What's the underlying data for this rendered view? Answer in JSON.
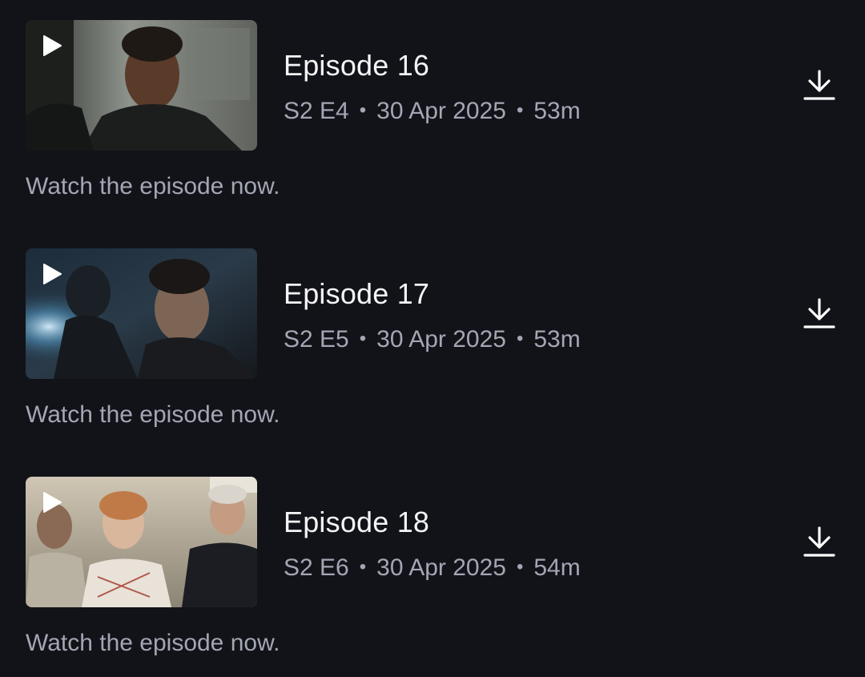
{
  "episodes": [
    {
      "title": "Episode 16",
      "season_episode": "S2 E4",
      "date": "30 Apr 2025",
      "duration": "53m",
      "description": "Watch the episode now."
    },
    {
      "title": "Episode 17",
      "season_episode": "S2 E5",
      "date": "30 Apr 2025",
      "duration": "53m",
      "description": "Watch the episode now."
    },
    {
      "title": "Episode 18",
      "season_episode": "S2 E6",
      "date": "30 Apr 2025",
      "duration": "54m",
      "description": "Watch the episode now."
    }
  ],
  "separator": "•",
  "icons": {
    "play": "play-icon",
    "download": "download-icon"
  },
  "colors": {
    "background": "#121318",
    "title": "#f4f4f6",
    "secondary_text": "#a3a6b4",
    "icon": "#ffffff"
  }
}
